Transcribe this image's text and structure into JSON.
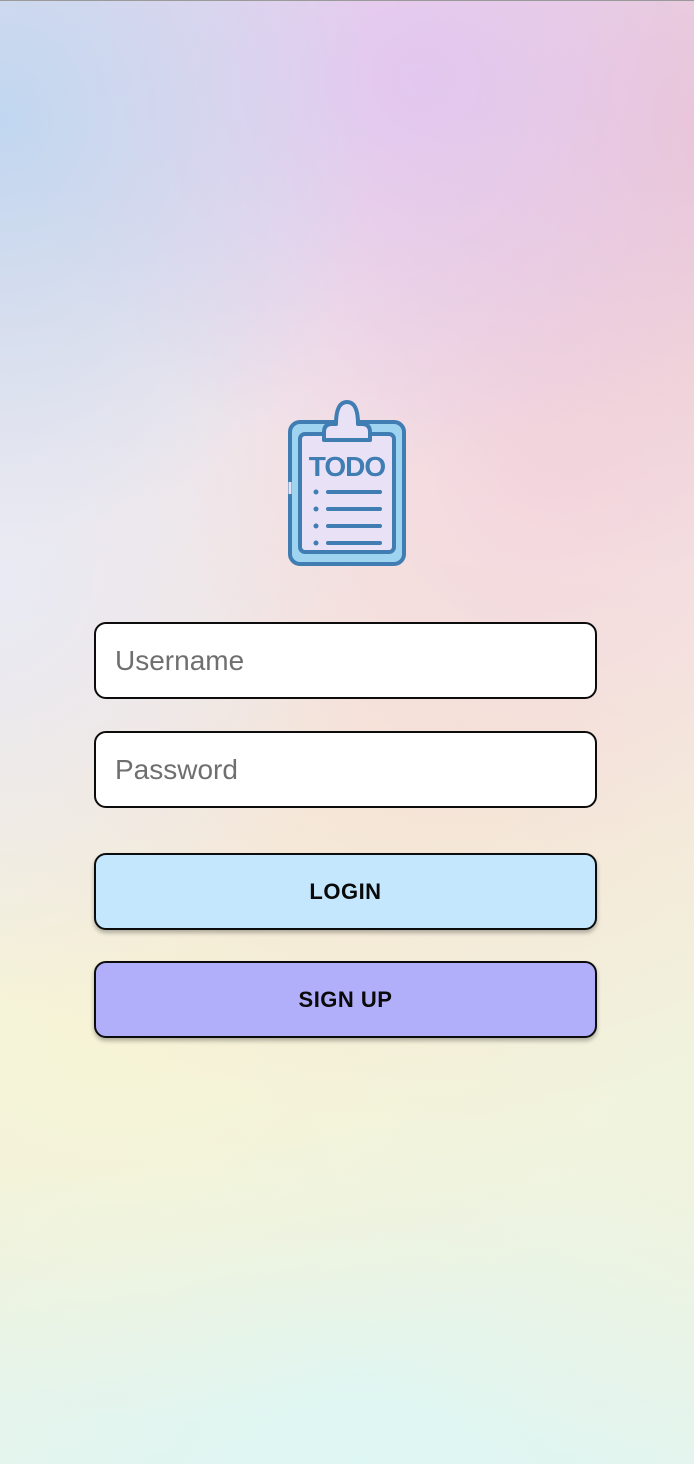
{
  "logo": {
    "text": "TODO",
    "icon": "clipboard-todo-icon",
    "colors": {
      "outline": "#3f7db3",
      "board": "#9fd4f0",
      "paper": "#e9e2f6",
      "text": "#3f7db3"
    }
  },
  "form": {
    "username": {
      "placeholder": "Username",
      "value": ""
    },
    "password": {
      "placeholder": "Password",
      "value": ""
    }
  },
  "buttons": {
    "login_label": "LOGIN",
    "signup_label": "SIGN UP"
  },
  "colors": {
    "login_button": "#c4e7fd",
    "signup_button": "#b1aefa",
    "field_background": "#ffffff",
    "border": "#0c0c0c"
  }
}
